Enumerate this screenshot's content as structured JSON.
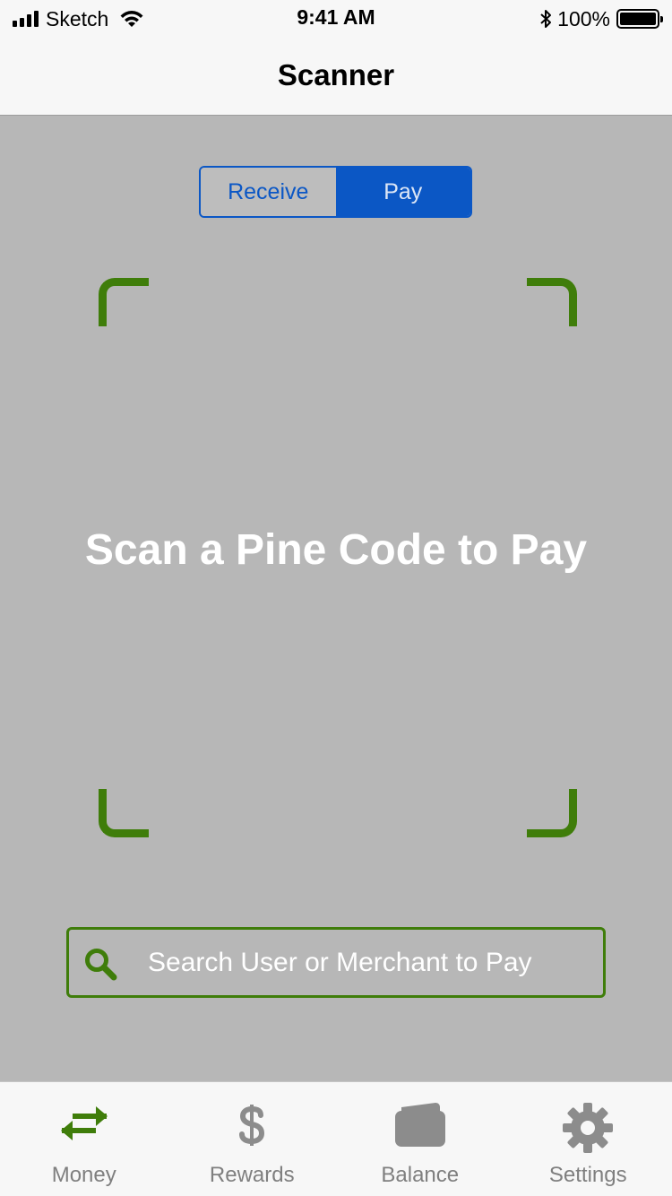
{
  "status_bar": {
    "carrier": "Sketch",
    "time": "9:41 AM",
    "battery": "100%"
  },
  "nav": {
    "title": "Scanner"
  },
  "segmented": {
    "options": [
      "Receive",
      "Pay"
    ],
    "selected": "Pay"
  },
  "scanner": {
    "prompt": "Scan a Pine Code to Pay"
  },
  "search": {
    "placeholder": "Search User or Merchant to Pay"
  },
  "tabs": [
    {
      "label": "Money",
      "icon": "transfer-arrows-icon"
    },
    {
      "label": "Rewards",
      "icon": "dollar-icon"
    },
    {
      "label": "Balance",
      "icon": "wallet-icon"
    },
    {
      "label": "Settings",
      "icon": "gear-icon"
    }
  ],
  "colors": {
    "accent_green": "#3f7d0a",
    "accent_blue": "#0b57c5",
    "scanner_bg": "#b7b7b7",
    "inactive_icon": "#8c8c8c"
  }
}
